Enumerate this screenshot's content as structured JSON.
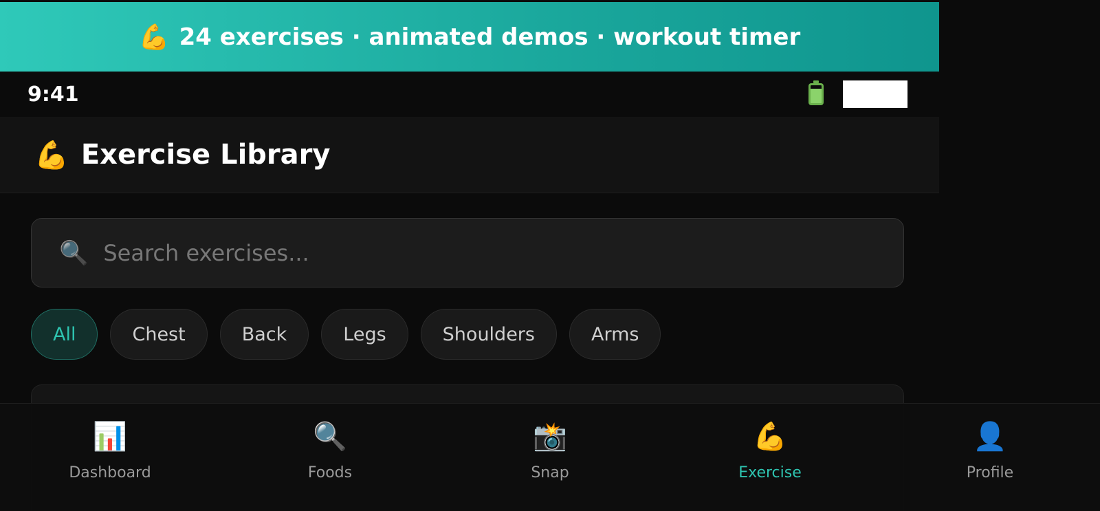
{
  "banner": {
    "icon": "flexed-biceps-icon",
    "emoji": "💪",
    "text": "24 exercises · animated demos · workout timer"
  },
  "status_bar": {
    "time": "9:41"
  },
  "header": {
    "icon": "flexed-biceps-icon",
    "emoji": "💪",
    "title": "Exercise Library"
  },
  "search": {
    "icon": "magnifying-glass-icon",
    "emoji": "🔍",
    "placeholder": "Search exercises..."
  },
  "filters": [
    {
      "label": "All",
      "active": true
    },
    {
      "label": "Chest",
      "active": false
    },
    {
      "label": "Back",
      "active": false
    },
    {
      "label": "Legs",
      "active": false
    },
    {
      "label": "Shoulders",
      "active": false
    },
    {
      "label": "Arms",
      "active": false
    }
  ],
  "bottom_nav": [
    {
      "label": "Dashboard",
      "icon": "bar-chart-icon",
      "emoji": "📊",
      "active": false
    },
    {
      "label": "Foods",
      "icon": "magnifying-glass-icon",
      "emoji": "🔍",
      "active": false
    },
    {
      "label": "Snap",
      "icon": "camera-icon",
      "emoji": "📸",
      "active": false
    },
    {
      "label": "Exercise",
      "icon": "flexed-biceps-icon",
      "emoji": "💪",
      "active": true
    },
    {
      "label": "Profile",
      "icon": "person-silhouette-icon",
      "emoji": "👤",
      "active": false
    }
  ],
  "colors": {
    "accent": "#2ec4b0",
    "banner_start": "#2fc9b9",
    "banner_end": "#0f958e",
    "background": "#0b0b0b"
  }
}
